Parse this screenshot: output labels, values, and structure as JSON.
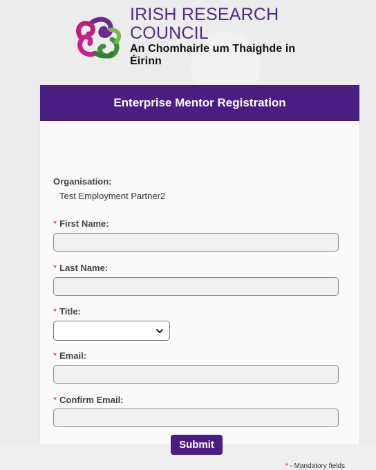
{
  "logo": {
    "line1": "IRISH RESEARCH COUNCIL",
    "line2": "An Chomhairle um Thaighde in Éirinn"
  },
  "card": {
    "title": "Enterprise Mentor Registration"
  },
  "organisation": {
    "label": "Organisation:",
    "value": "Test Employment Partner2"
  },
  "fields": {
    "first_name": {
      "required_marker": "*",
      "label": "First Name:",
      "value": ""
    },
    "last_name": {
      "required_marker": "*",
      "label": "Last Name:",
      "value": ""
    },
    "title": {
      "required_marker": "*",
      "label": "Title:",
      "value": ""
    },
    "email": {
      "required_marker": "*",
      "label": "Email:",
      "value": ""
    },
    "confirm_email": {
      "required_marker": "*",
      "label": "Confirm Email:",
      "value": ""
    }
  },
  "submit_label": "Submit",
  "mandatory_note": {
    "marker": "*",
    "text": " - Mandatory fields"
  },
  "colors": {
    "brand_purple": "#4b1d82",
    "required_red": "#cc2222"
  },
  "icons": {
    "logo": "irish-research-council-logo-icon",
    "select_arrow": "chevron-down-icon"
  }
}
